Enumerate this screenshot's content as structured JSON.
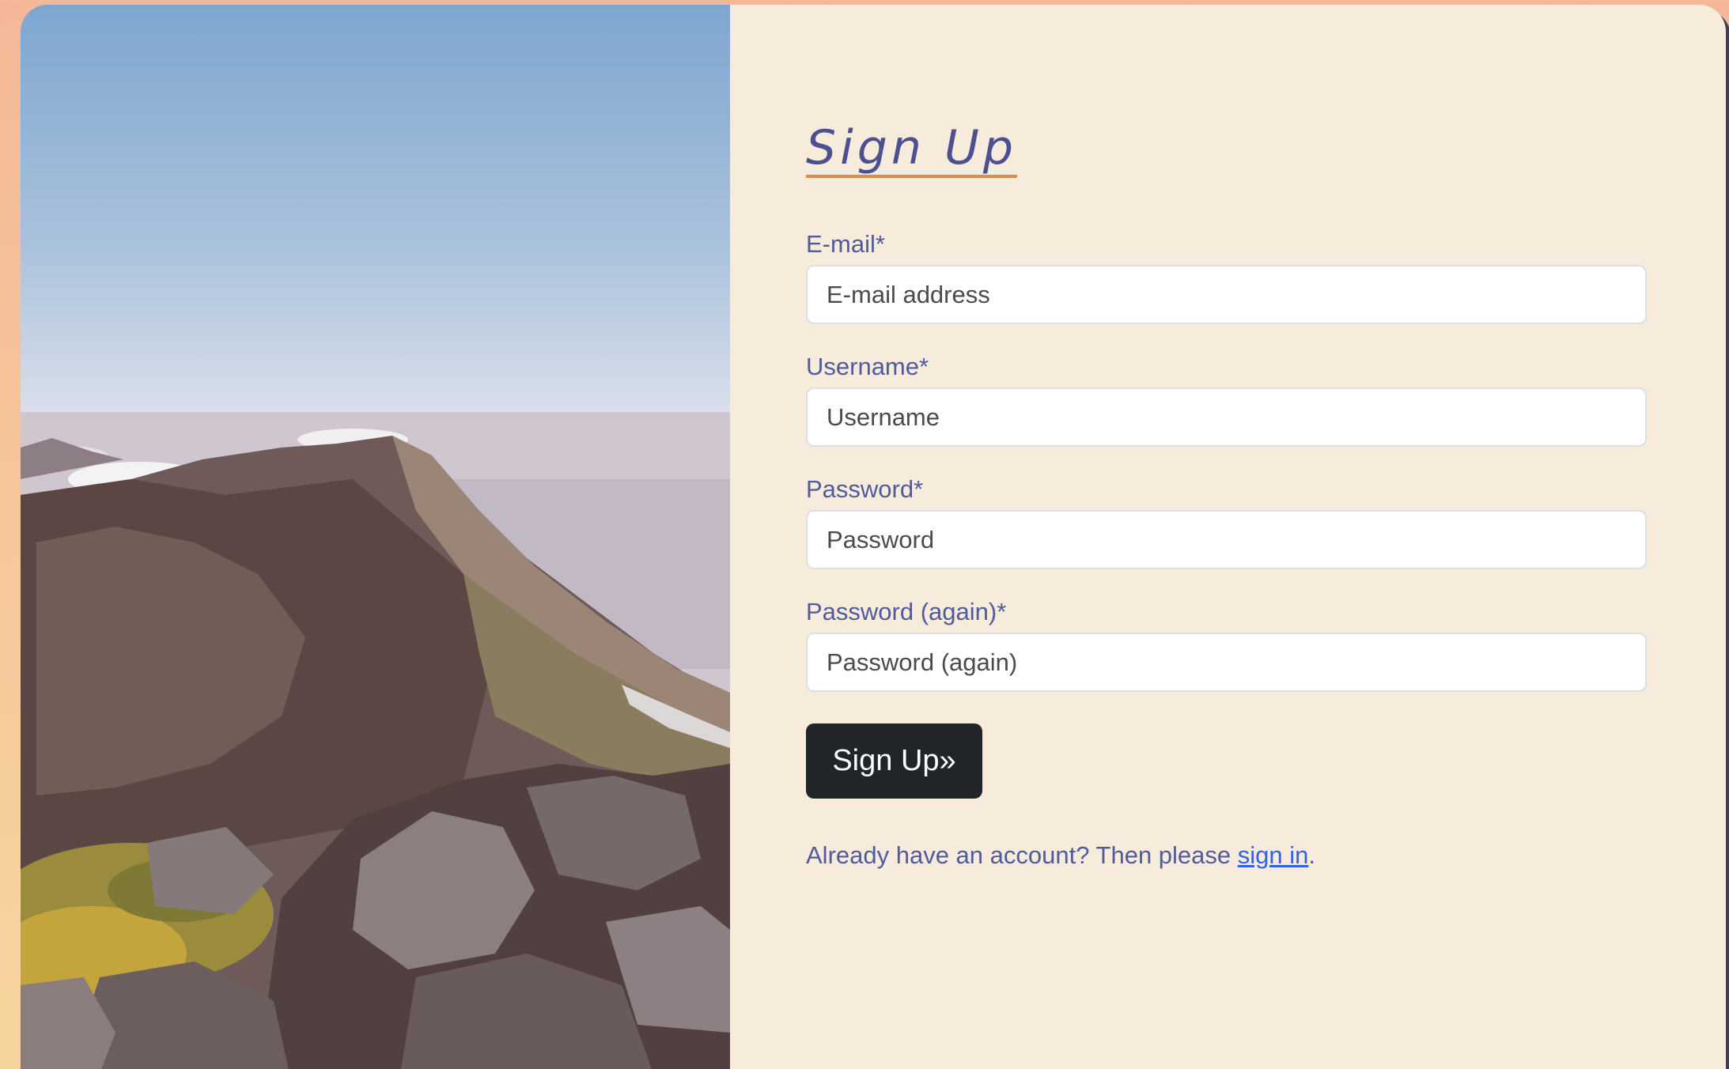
{
  "form": {
    "title": "Sign Up",
    "fields": [
      {
        "label": "E-mail*",
        "placeholder": "E-mail address"
      },
      {
        "label": "Username*",
        "placeholder": "Username"
      },
      {
        "label": "Password*",
        "placeholder": "Password"
      },
      {
        "label": "Password (again)*",
        "placeholder": "Password (again)"
      }
    ],
    "submit_label": "Sign Up»",
    "footer_prefix": "Already have an account? Then please ",
    "footer_link": "sign in",
    "footer_suffix": "."
  },
  "colors": {
    "accent_underline": "#e08a4a",
    "label_text": "#4f5b9d",
    "button_bg": "#212529",
    "link": "#2e63e7",
    "panel_bg": "#f7ebdb"
  }
}
